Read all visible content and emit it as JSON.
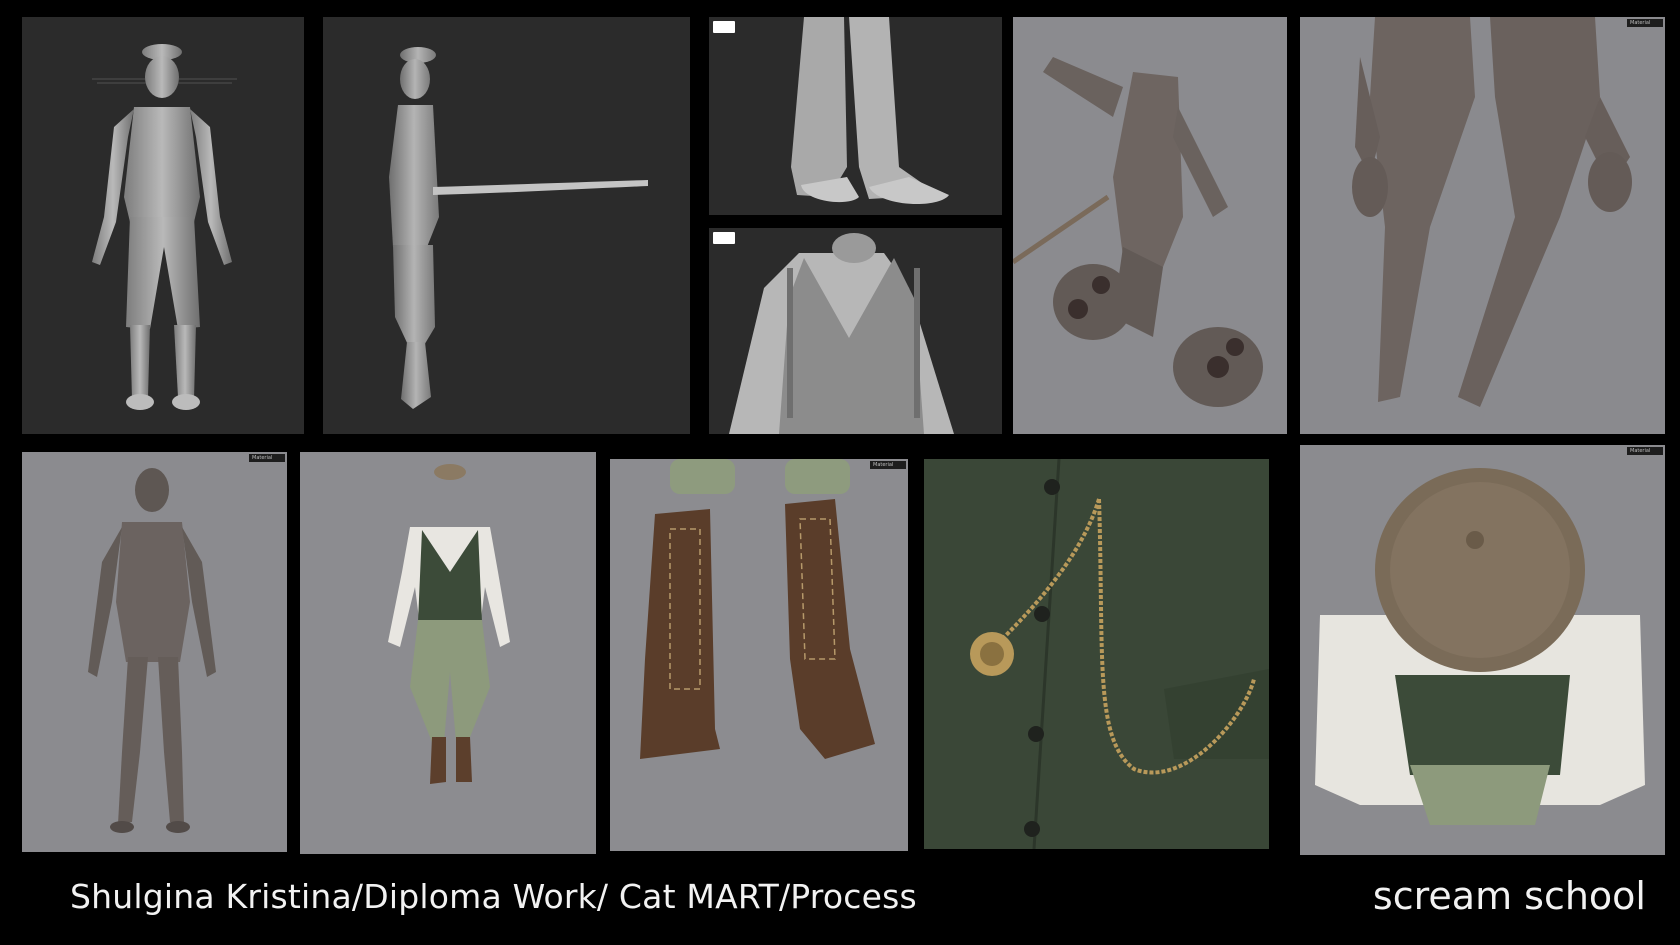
{
  "caption": {
    "text": "Shulgina Kristina/Diploma Work/ Cat MART/Process"
  },
  "brand": {
    "text": "scream school"
  },
  "viewport_tags": {
    "material": "Material"
  },
  "panels": [
    {
      "id": "sculpt-front",
      "subject": "clothed character sculpt, front view",
      "style": "grey clay"
    },
    {
      "id": "sculpt-side",
      "subject": "clothed character sculpt, side view with tail",
      "style": "grey clay"
    },
    {
      "id": "sculpt-boots",
      "subject": "lace-up boots sculpt close-up",
      "style": "grey clay"
    },
    {
      "id": "sculpt-vest",
      "subject": "shirt and vest with suspenders sculpt close-up",
      "style": "grey clay"
    },
    {
      "id": "body-paws",
      "subject": "anatomy render viewed from below with paws",
      "style": "grey-brown render"
    },
    {
      "id": "body-legs",
      "subject": "anatomy render of legs and hands",
      "style": "grey-brown render"
    },
    {
      "id": "body-full",
      "subject": "full body anatomy render of cat character",
      "style": "grey-brown render"
    },
    {
      "id": "outfit",
      "subject": "textured outfit: cap, shirt, green vest, trousers, boots",
      "style": "textured render"
    },
    {
      "id": "boots",
      "subject": "textured brown leather lace-up boots",
      "style": "textured render"
    },
    {
      "id": "watch-chain",
      "subject": "green vest with gold pocket watch chain and paw emblem",
      "style": "textured render"
    },
    {
      "id": "top-view",
      "subject": "top view of character with flat cap",
      "style": "textured render"
    }
  ],
  "colors": {
    "background": "#000000",
    "sculpt_bg": "#2a2a2a",
    "render_bg": "#8a8a8e",
    "clay": "#a8a8a8",
    "skin": "#6f6661",
    "vest_green": "#3b4a38",
    "trouser_green": "#8e9a7c",
    "leather": "#5a3d2a",
    "gold": "#b89a5a",
    "text": "#f2f2f2"
  }
}
